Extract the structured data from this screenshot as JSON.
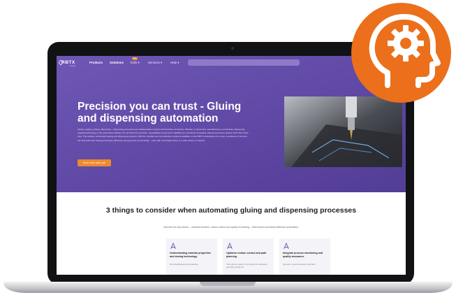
{
  "nav": {
    "logo": "RBTX",
    "logo_sub": "by igus",
    "items": [
      "Products",
      "Solutions",
      "Tools ▾",
      "Services ▾",
      "Help ▾"
    ],
    "badge": "NEW"
  },
  "hero": {
    "title": "Precision you can trust - Gluing and dispensing automation",
    "body": "Gluing, sealing, potting, dispensing – dispensing processes are indispensable in almost all branches of industry. Whether in electronics manufacturing, mechanical engineering, medical technology or the automotive industry, the demands for precision, repeatability and process reliability are constantly increasing. Manual processes quickly reach their limits here. The solution: automated dosing and dispensing systems. With the modular and cost-effective solutions available on the RBTX marketplace from igus, companies of all sizes can automate their dosing processes efficiently, precisely and economically – even with small batch sizes or a wide variety of variants.",
    "cta": "Book a free video call"
  },
  "section": {
    "title": "3 things to consider when automating gluing and dispensing processes",
    "subtitle": "Discover the key factors – material behavior, motion control and quality monitoring – that ensure successful adhesive automation."
  },
  "cards": [
    {
      "title": "Understanding material properties and dosing technology",
      "text": "Not all adhesives and sealants"
    },
    {
      "title": "Optimise motion control and path planning",
      "text": "The robot or gantry must apply the adhesive precisely along the"
    },
    {
      "title": "Integrate process monitoring and quality assurance",
      "text": "Sensors, camera systems and flow"
    }
  ],
  "colors": {
    "hero": "#5e46a3",
    "accent": "#ee8a2e",
    "badge": "#ec6f1b"
  },
  "icons": {
    "badge": "head-gear-icon",
    "card": "pen-nib-icon"
  }
}
